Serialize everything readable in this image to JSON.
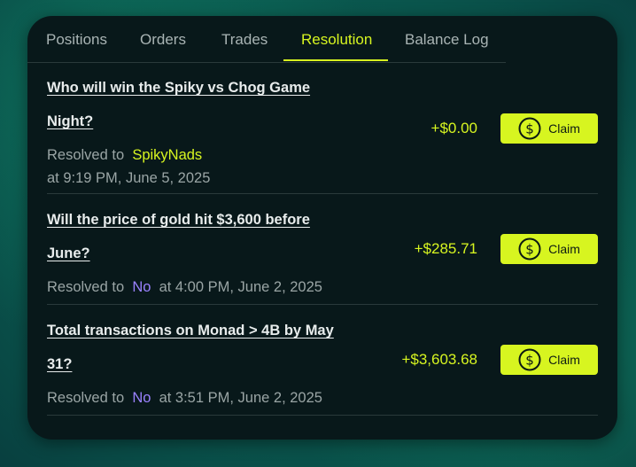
{
  "tabs": [
    {
      "label": "Positions",
      "active": false
    },
    {
      "label": "Orders",
      "active": false
    },
    {
      "label": "Trades",
      "active": false
    },
    {
      "label": "Resolution",
      "active": true
    },
    {
      "label": "Balance Log",
      "active": false
    }
  ],
  "items": [
    {
      "question_line1": "Who will win the Spiky vs Chog Game",
      "question_line2": "Night?",
      "resolved_prefix": "Resolved to",
      "outcome": "SpikyNads",
      "outcome_color": "#d7f520",
      "time": "at 9:19 PM, June 5, 2025",
      "amount": "+$0.00",
      "claim_label": "Claim"
    },
    {
      "question_line1": "Will the price of gold hit $3,600 before",
      "question_line2": "June?",
      "resolved_prefix": "Resolved to",
      "outcome": "No",
      "outcome_color": "#9b82ff",
      "time": "at 4:00 PM, June 2, 2025",
      "amount": "+$285.71",
      "claim_label": "Claim"
    },
    {
      "question_line1": "Total transactions on Monad > 4B by May",
      "question_line2": "31?",
      "resolved_prefix": "Resolved to",
      "outcome": "No",
      "outcome_color": "#9b82ff",
      "time": "at 3:51 PM, June 2, 2025",
      "amount": "+$3,603.68",
      "claim_label": "Claim"
    }
  ],
  "colors": {
    "accent": "#d7f520",
    "outcome_no": "#9b82ff",
    "card_bg": "#08181a"
  },
  "icons": {
    "claim": "dollar-coin-icon"
  }
}
